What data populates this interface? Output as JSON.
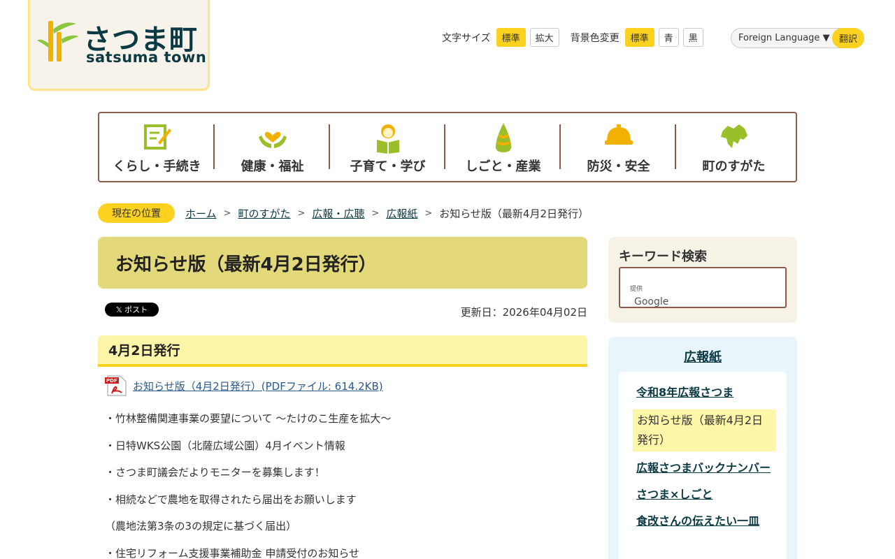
{
  "logo": {
    "jp": "さつま町",
    "en": "satsuma town"
  },
  "tools": {
    "font_size_label": "文字サイズ",
    "font_standard": "標準",
    "font_large": "拡大",
    "bg_label": "背景色変更",
    "bg_standard": "標準",
    "bg_blue": "青",
    "bg_black": "黒",
    "language": "Foreign Language",
    "translate": "翻訳"
  },
  "nav": [
    {
      "label": "くらし・手続き",
      "icon": "document-pen-icon"
    },
    {
      "label": "健康・福祉",
      "icon": "heart-hands-icon"
    },
    {
      "label": "子育て・学び",
      "icon": "child-book-icon"
    },
    {
      "label": "しごと・産業",
      "icon": "bamboo-shoot-icon"
    },
    {
      "label": "防災・安全",
      "icon": "helmet-icon"
    },
    {
      "label": "町のすがた",
      "icon": "town-map-icon"
    }
  ],
  "breadcrumb": {
    "here": "現在の位置",
    "items": [
      "ホーム",
      "町のすがた",
      "広報・広聴",
      "広報紙"
    ],
    "current": "お知らせ版（最新4月2日発行）"
  },
  "page": {
    "title": "お知らせ版（最新4月2日発行）",
    "post": "𝕏 ポスト",
    "updated": "更新日：2026年04月02日",
    "subheading": "4月2日発行",
    "pdf_link": "お知らせ版（4月2日発行）(PDFファイル: 614.2KB)",
    "lines": [
      "・竹林整備関連事業の要望について ～たけのこ生産を拡大～",
      "・日特WKS公園（北薩広域公園）4月イベント情報",
      "・さつま町議会だよりモニターを募集します！",
      "・相続などで農地を取得されたら届出をお願いします",
      "（農地法第3条の3の規定に基づく届出）",
      "・住宅リフォーム支援事業補助金 申請受付のお知らせ"
    ]
  },
  "sidebar": {
    "search_title": "キーワード検索",
    "search_brand": "Google",
    "search_brand_sub": "提供",
    "section_title": "広報紙",
    "items": [
      "令和8年広報さつま",
      "お知らせ版（最新4月2日発行）",
      "広報さつまバックナンバー",
      "さつま×しごと",
      "食改さんの伝えたい一皿"
    ]
  },
  "colors": {
    "accent": "#fdd11f",
    "brand": "#0b3a44",
    "title_bg": "#e3d97a",
    "nav_border": "#8a5a4a"
  }
}
